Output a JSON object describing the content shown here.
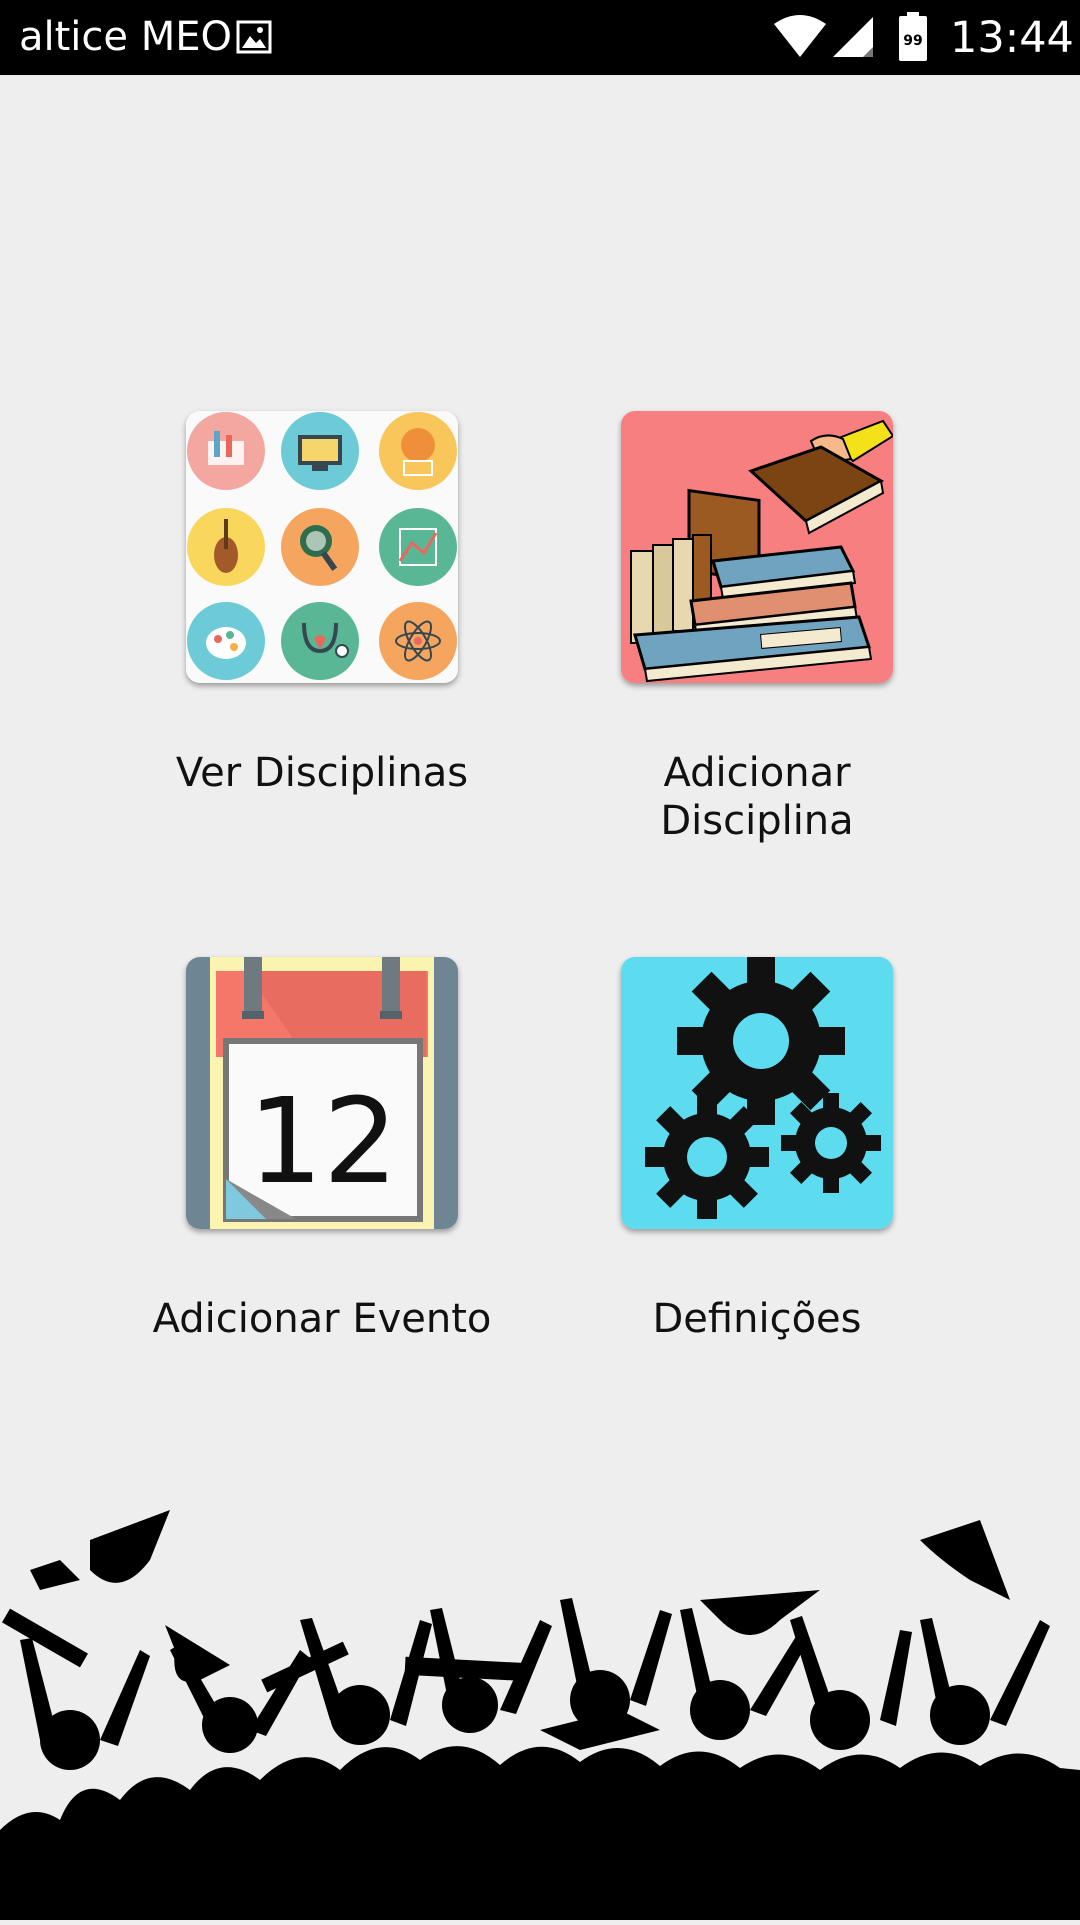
{
  "status_bar": {
    "carrier": "altice MEO",
    "battery_level": "99",
    "time": "13:44",
    "icons": [
      "gallery-icon",
      "wifi-icon",
      "signal-icon",
      "battery-icon"
    ]
  },
  "menu": {
    "ver_disciplinas": "Ver Disciplinas",
    "adicionar_disciplina": "Adicionar Disciplina",
    "adicionar_evento": "Adicionar Evento",
    "definicoes": "Definições"
  },
  "calendar": {
    "day": "12"
  },
  "colors": {
    "background": "#eeeeee",
    "status_bar": "#000000",
    "books_bg": "#f77f80",
    "settings_bg": "#5ddcf0",
    "calendar_red": "#f5776a"
  }
}
